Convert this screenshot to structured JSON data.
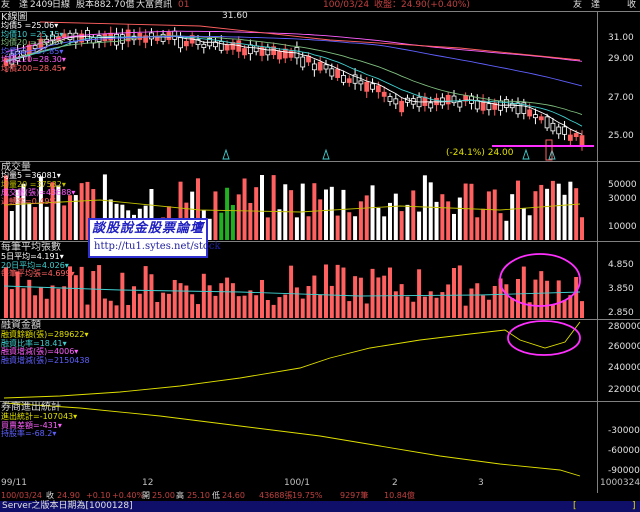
{
  "header": {
    "stock_name": "友　達",
    "stock_code": "2409",
    "period": "日線",
    "equity": "股本882.70億",
    "source": "大富資訊",
    "count": "01",
    "date": "100/03/24",
    "close_info": "收盤：24.90(+0.40%)",
    "right_name": "友　達",
    "right_close": "收"
  },
  "kline": {
    "title": "K線圖",
    "legend": [
      {
        "label": "均價5 =25.06▾",
        "color": "#ffffff"
      },
      {
        "label": "均價10 =25.15▾",
        "color": "#40d0d0"
      },
      {
        "label": "均價20 =26.00▾",
        "color": "#80c080"
      },
      {
        "label": "均價60 =27.85▾",
        "color": "#6060ff"
      },
      {
        "label": "均價120=28.30▾",
        "color": "#ff60ff"
      },
      {
        "label": "均價200=28.45▾",
        "color": "#ff6060"
      }
    ],
    "high_label": "31.60",
    "low_label": "(-24.1%) 24.00",
    "yticks": [
      "31.00",
      "29.00",
      "27.00",
      "25.00"
    ]
  },
  "volume": {
    "title": "成交量",
    "legend": [
      {
        "label": "均量5 =36081▾",
        "color": "#ffffff"
      },
      {
        "label": "均量20 =37532▾",
        "color": "#c0c000"
      },
      {
        "label": "成交量(張)=43688▾",
        "color": "#ff60ff"
      },
      {
        "label": "週轉率=0.49%",
        "color": "#ff6060"
      }
    ],
    "yticks": [
      "50000",
      "30000",
      "10000"
    ]
  },
  "promo": {
    "title": "談股說金股票論壇",
    "url": "http://tu1.sytes.net/stock"
  },
  "avgvol": {
    "title": "每筆平均張數",
    "legend": [
      {
        "label": "5日平均=4.191▾",
        "color": "#ffffff"
      },
      {
        "label": "20日平均=4.026▾",
        "color": "#40d0d0"
      },
      {
        "label": "每筆平均張=4.699▾",
        "color": "#ff6060"
      }
    ],
    "yticks": [
      "4.850",
      "3.850",
      "2.850"
    ]
  },
  "margin": {
    "title": "融資金額",
    "legend": [
      {
        "label": "融資餘額(張)=289622▾",
        "color": "#e0e000"
      },
      {
        "label": "融資比率=18.41▾",
        "color": "#40d0d0"
      },
      {
        "label": "融資增減(張)=4006▾",
        "color": "#ff60ff"
      },
      {
        "label": "融資增減(張)=2150438",
        "color": "#6060ff"
      }
    ],
    "yticks": [
      "280000",
      "260000",
      "240000",
      "220000"
    ]
  },
  "foreign": {
    "title": "券商進出統計",
    "legend": [
      {
        "label": "進出統計=-107043▾",
        "color": "#e0e000"
      },
      {
        "label": "買賣差額=-431▾",
        "color": "#ff60ff"
      },
      {
        "label": "持股率=-68.2▾",
        "color": "#6060ff"
      }
    ],
    "yticks": [
      "-30000",
      "-60000",
      "-90000"
    ]
  },
  "xaxis": [
    {
      "label": "99/11"
    },
    {
      "label": "12"
    },
    {
      "label": "100/1"
    },
    {
      "label": "2"
    },
    {
      "label": "3"
    }
  ],
  "xaxis_end": "1000324",
  "status": {
    "date": "100/03/24",
    "close_lbl": "收",
    "close": "24.90",
    "change": "+0.10",
    "change_pct": "+0.40%",
    "open_lbl": "開",
    "open": "25.00",
    "high_lbl": "高",
    "high": "25.10",
    "low_lbl": "低",
    "low": "24.60",
    "volume": "43688張",
    "turnover": "19.75%",
    "trades": "9297筆",
    "amount": "10.84億"
  },
  "server": {
    "text": "Server之版本日期為[1000128]"
  },
  "colors": {
    "up": "#ff6060",
    "down": "#ffffff",
    "flat": "#20b020",
    "highlight": "#ff30ff"
  }
}
